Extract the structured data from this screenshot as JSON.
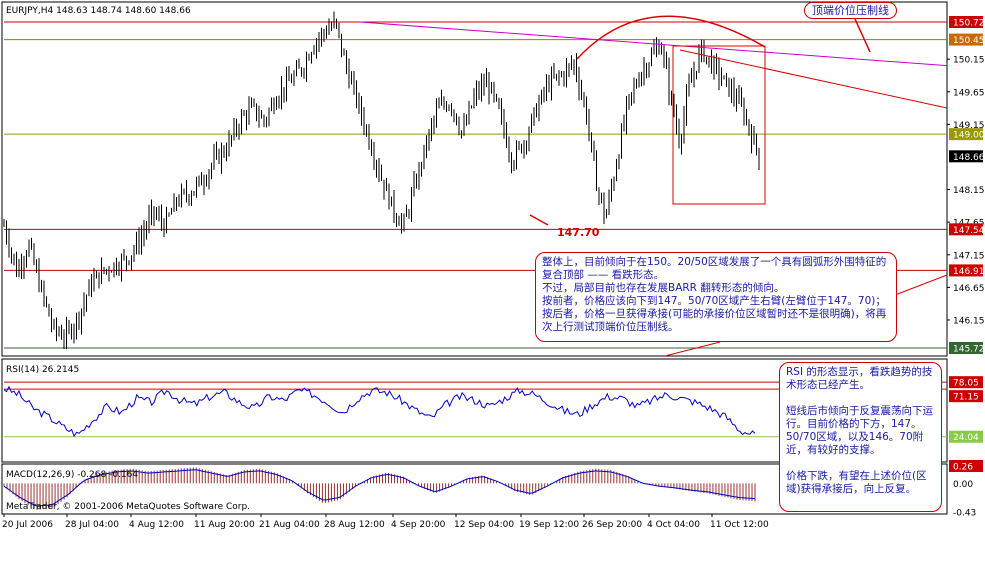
{
  "chart_data": {
    "type": "candlestick",
    "symbol_header": "EURJPY,H4  148.63 148.74 148.60 148.66",
    "price_axis": {
      "ticks": [
        "150.72",
        "150.45",
        "150.15",
        "149.65",
        "149.15",
        "149.00",
        "148.66",
        "148.15",
        "147.65",
        "147.54",
        "147.15",
        "146.91",
        "146.65",
        "146.15",
        "145.72"
      ],
      "ylim": [
        145.72,
        150.72
      ]
    },
    "highlighted_prices": [
      {
        "value": "150.72",
        "color": "#cc0000"
      },
      {
        "value": "150.45",
        "color": "#cc6600"
      },
      {
        "value": "149.00",
        "color": "#999900"
      },
      {
        "value": "148.66",
        "color": "#000000"
      },
      {
        "value": "147.54",
        "color": "#cc0000"
      },
      {
        "value": "146.91",
        "color": "#cc0000"
      },
      {
        "value": "145.72",
        "color": "#336633"
      }
    ],
    "time_axis": [
      "20 Jul 2006",
      "28 Jul 04:00",
      "4 Aug 12:00",
      "11 Aug 20:00",
      "21 Aug 04:00",
      "28 Aug 12:00",
      "4 Sep 20:00",
      "12 Sep 04:00",
      "19 Sep 12:00",
      "26 Sep 20:00",
      "4 Oct 04:00",
      "11 Oct 12:00"
    ],
    "price_path": [
      [
        0,
        147.6
      ],
      [
        8,
        146.9
      ],
      [
        16,
        147.3
      ],
      [
        24,
        146.6
      ],
      [
        32,
        146.0
      ],
      [
        40,
        145.9
      ],
      [
        48,
        146.2
      ],
      [
        56,
        146.7
      ],
      [
        64,
        146.9
      ],
      [
        72,
        147.0
      ],
      [
        80,
        147.1
      ],
      [
        88,
        147.4
      ],
      [
        96,
        147.8
      ],
      [
        104,
        147.6
      ],
      [
        112,
        148.0
      ],
      [
        120,
        148.1
      ],
      [
        128,
        148.3
      ],
      [
        136,
        148.6
      ],
      [
        144,
        148.8
      ],
      [
        152,
        149.2
      ],
      [
        160,
        149.4
      ],
      [
        168,
        149.2
      ],
      [
        176,
        149.6
      ],
      [
        184,
        149.8
      ],
      [
        192,
        150.0
      ],
      [
        200,
        150.4
      ],
      [
        208,
        150.6
      ],
      [
        214,
        150.7
      ],
      [
        220,
        150.1
      ],
      [
        228,
        149.5
      ],
      [
        236,
        148.9
      ],
      [
        244,
        148.3
      ],
      [
        252,
        147.8
      ],
      [
        258,
        147.6
      ],
      [
        264,
        148.1
      ],
      [
        272,
        148.8
      ],
      [
        280,
        149.4
      ],
      [
        288,
        149.5
      ],
      [
        296,
        149.0
      ],
      [
        304,
        149.6
      ],
      [
        312,
        149.8
      ],
      [
        320,
        149.3
      ],
      [
        328,
        148.6
      ],
      [
        336,
        148.9
      ],
      [
        344,
        149.4
      ],
      [
        352,
        149.8
      ],
      [
        360,
        149.9
      ],
      [
        368,
        150.1
      ],
      [
        376,
        149.3
      ],
      [
        382,
        148.3
      ],
      [
        388,
        147.7
      ],
      [
        394,
        148.4
      ],
      [
        402,
        149.4
      ],
      [
        410,
        149.9
      ],
      [
        418,
        150.2
      ],
      [
        424,
        150.4
      ],
      [
        430,
        149.6
      ],
      [
        436,
        148.9
      ],
      [
        442,
        149.7
      ],
      [
        450,
        150.3
      ],
      [
        456,
        150.1
      ],
      [
        462,
        149.9
      ],
      [
        468,
        149.7
      ],
      [
        474,
        149.5
      ],
      [
        478,
        149.3
      ],
      [
        482,
        149.0
      ],
      [
        488,
        148.66
      ]
    ],
    "rsi": {
      "label": "RSI(14) 26.2145",
      "ticks": [
        "78.05",
        "71.15",
        "24.04"
      ],
      "ylim": [
        0,
        100
      ],
      "values": [
        72,
        66,
        52,
        44,
        34,
        26,
        40,
        54,
        48,
        62,
        58,
        70,
        60,
        56,
        64,
        68,
        58,
        52,
        64,
        60,
        70,
        66,
        58,
        48,
        62,
        70,
        68,
        60,
        50,
        42,
        56,
        64,
        60,
        54,
        62,
        70,
        66,
        58,
        50,
        46,
        56,
        64,
        62,
        54,
        60,
        66,
        62,
        58,
        52,
        44,
        30,
        26
      ]
    },
    "macd": {
      "label": "MACD(12,26,9) -0.268 -0.164",
      "ticks": [
        "0.26",
        "0.00",
        "-0.43"
      ],
      "ylim": [
        -0.43,
        0.26
      ],
      "hist": [
        -0.05,
        -0.25,
        -0.4,
        -0.38,
        -0.2,
        0.05,
        0.15,
        0.2,
        0.22,
        0.18,
        0.2,
        0.22,
        0.24,
        0.18,
        0.12,
        0.2,
        0.22,
        0.16,
        0.05,
        -0.15,
        -0.3,
        -0.25,
        -0.05,
        0.1,
        0.16,
        0.1,
        -0.05,
        -0.15,
        -0.05,
        0.08,
        0.12,
        0.02,
        -0.12,
        -0.18,
        -0.05,
        0.1,
        0.18,
        0.22,
        0.2,
        0.12,
        0.0,
        -0.05,
        -0.08,
        -0.12,
        -0.15,
        -0.2,
        -0.25,
        -0.27
      ]
    }
  },
  "copyright": "MetaTrader, © 2001-2006 MetaQuotes Software Corp.",
  "annotations": {
    "top_tag": "顶端价位压制线",
    "low_label": "147.70",
    "main_note": "整体上，目前倾向于在150。20/50区域发展了一个具有圆弧形外围特征的复合顶部 —— 看跌形态。\n不过，局部目前也存在发展BARR 翻转形态的倾向。\n按前者，价格应该向下到147。50/70区域产生右臂(左臂位于147。70)；\n按后者，价格一旦获得承接(可能的承接价位区域暂时还不是很明确)，将再次上行测试顶端价位压制线。",
    "rsi_note": "RSI 的形态显示，看跌趋势的技术形态已经产生。\n\n短线后市倾向于反复震荡向下运行。目前价格的下方，147。50/70区域，以及146。70附近，有较好的支撑。\n\n价格下跌，有望在上述价位(区域)获得承接后，向上反复。"
  },
  "colors": {
    "annotation_line": "#dd0000",
    "annotation_text": "#1a1aa6",
    "rsi_line": "#0000cc",
    "macd_line": "#0000cc",
    "macd_hist": "#993333"
  }
}
